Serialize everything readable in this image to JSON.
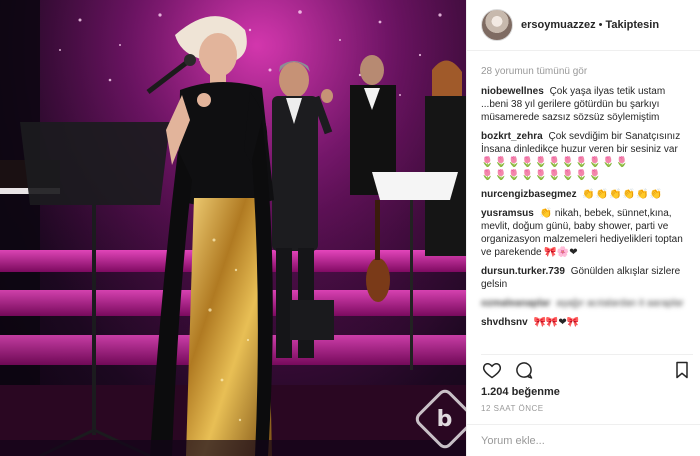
{
  "post": {
    "username": "ersoymuazzez",
    "separator": "•",
    "follow_status": "Takiptesin"
  },
  "view_all_comments": "28 yorumun tümünü gör",
  "comments": [
    {
      "user": "niobewellnes",
      "text": "Çok yaşa ilyas tetik ustam ...beni 38 yıl gerilere götürdün bu şarkıyı müsamerede sazsız sözsüz söylemiştim"
    },
    {
      "user": "bozkrt_zehra",
      "text": "Çok sevdiğim bir Sanatçısınız İnsana dinledikçe huzur veren bir sesiniz var"
    },
    {
      "user": "nurcengizbasegmez",
      "text": ""
    },
    {
      "user": "yusramsus",
      "text": "nikah, bebek, sünnet,kına, mevlit, doğum günü, baby shower, parti ve organizasyon malzemeleri hediyelikleri toptan ve parekende"
    },
    {
      "user": "dursun.turker.739",
      "text": "Gönülden alkışlar sizlere gelsin"
    },
    {
      "user": "ozmaleanaplar",
      "text": "aşağır acıtalardan it aaraplar"
    },
    {
      "user": "shvdhsnv",
      "text": ""
    }
  ],
  "emoji": {
    "tulips_row1": "🌷🌷🌷🌷🌷🌷🌷🌷🌷🌷🌷",
    "tulips_row2": "🌷🌷🌷🌷🌷🌷🌷🌷🌷",
    "claps": "👏👏👏👏👏👏",
    "yusra_lead": "👏",
    "yusra_trail": "🎀🌸❤",
    "shvd": "🎀🎀❤🎀"
  },
  "likes": "1.204 beğenme",
  "timestamp": "12 SAAT ÖNCE",
  "add_comment": {
    "placeholder": "Yorum ekle..."
  },
  "watermark": "b",
  "icons": {
    "like": "heart-icon",
    "comment": "comment-icon",
    "bookmark": "bookmark-icon"
  },
  "colors": {
    "stage_magenta": "#c0178f",
    "gold_skirt": "#c8962e",
    "text_primary": "#262626",
    "text_muted": "#999999"
  }
}
